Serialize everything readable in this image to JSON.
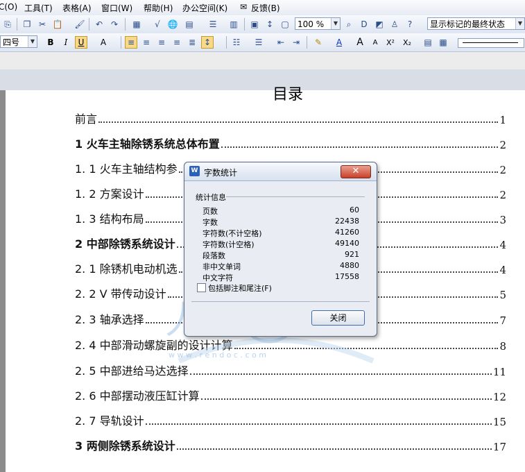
{
  "menu": [
    "C(O)",
    "工具(T)",
    "表格(A)",
    "窗口(W)",
    "帮助(H)",
    "办公空间(K)",
    "反馈(B)"
  ],
  "toolbar": {
    "zoom": "100 %",
    "markup_view": "显示标记的最终状态",
    "font_size": "四号",
    "bold": "B",
    "italic": "I",
    "underline": "U",
    "char_shade": "A",
    "grow_font": "A",
    "shrink_font": "A",
    "superscript": "X²",
    "subscript": "X₂"
  },
  "document": {
    "title": "目录",
    "toc": [
      {
        "text": "前言",
        "page": "1"
      },
      {
        "text": "1 火车主轴除锈系统总体布置",
        "page": "2"
      },
      {
        "text": "1. 1  火车主轴结构参",
        "page": "2"
      },
      {
        "text": "1. 2  方案设计",
        "page": "2"
      },
      {
        "text": "1. 3  结构布局",
        "page": "3"
      },
      {
        "text": "2  中部除锈系统设计",
        "page": "4"
      },
      {
        "text": "2. 1  除锈机电动机选",
        "page": "4"
      },
      {
        "text": "2. 2  V 带传动设计",
        "page": "5"
      },
      {
        "text": "2. 3  轴承选择",
        "page": "7"
      },
      {
        "text": "2. 4  中部滑动螺旋副的设计计算",
        "page": "8"
      },
      {
        "text": "2. 5  中部进给马达选择",
        "page": "11"
      },
      {
        "text": "2. 6  中部摆动液压缸计算",
        "page": "12"
      },
      {
        "text": "2. 7  导轨设计",
        "page": "15"
      },
      {
        "text": "3  两侧除锈系统设计",
        "page": "17"
      }
    ]
  },
  "watermark": {
    "text": "人人文库",
    "url": "w w w . r e n d o c . c o m"
  },
  "dialog": {
    "title": "字数统计",
    "app_icon": "W",
    "close_x": "✕",
    "group": "统计信息",
    "stats": [
      {
        "label": "页数",
        "value": "60"
      },
      {
        "label": "字数",
        "value": "22438"
      },
      {
        "label": "字符数(不计空格)",
        "value": "41260"
      },
      {
        "label": "字符数(计空格)",
        "value": "49140"
      },
      {
        "label": "段落数",
        "value": "921"
      },
      {
        "label": "非中文单词",
        "value": "4880"
      },
      {
        "label": "中文字符",
        "value": "17558"
      }
    ],
    "include_notes": "包括脚注和尾注(F)",
    "close_button": "关闭"
  }
}
